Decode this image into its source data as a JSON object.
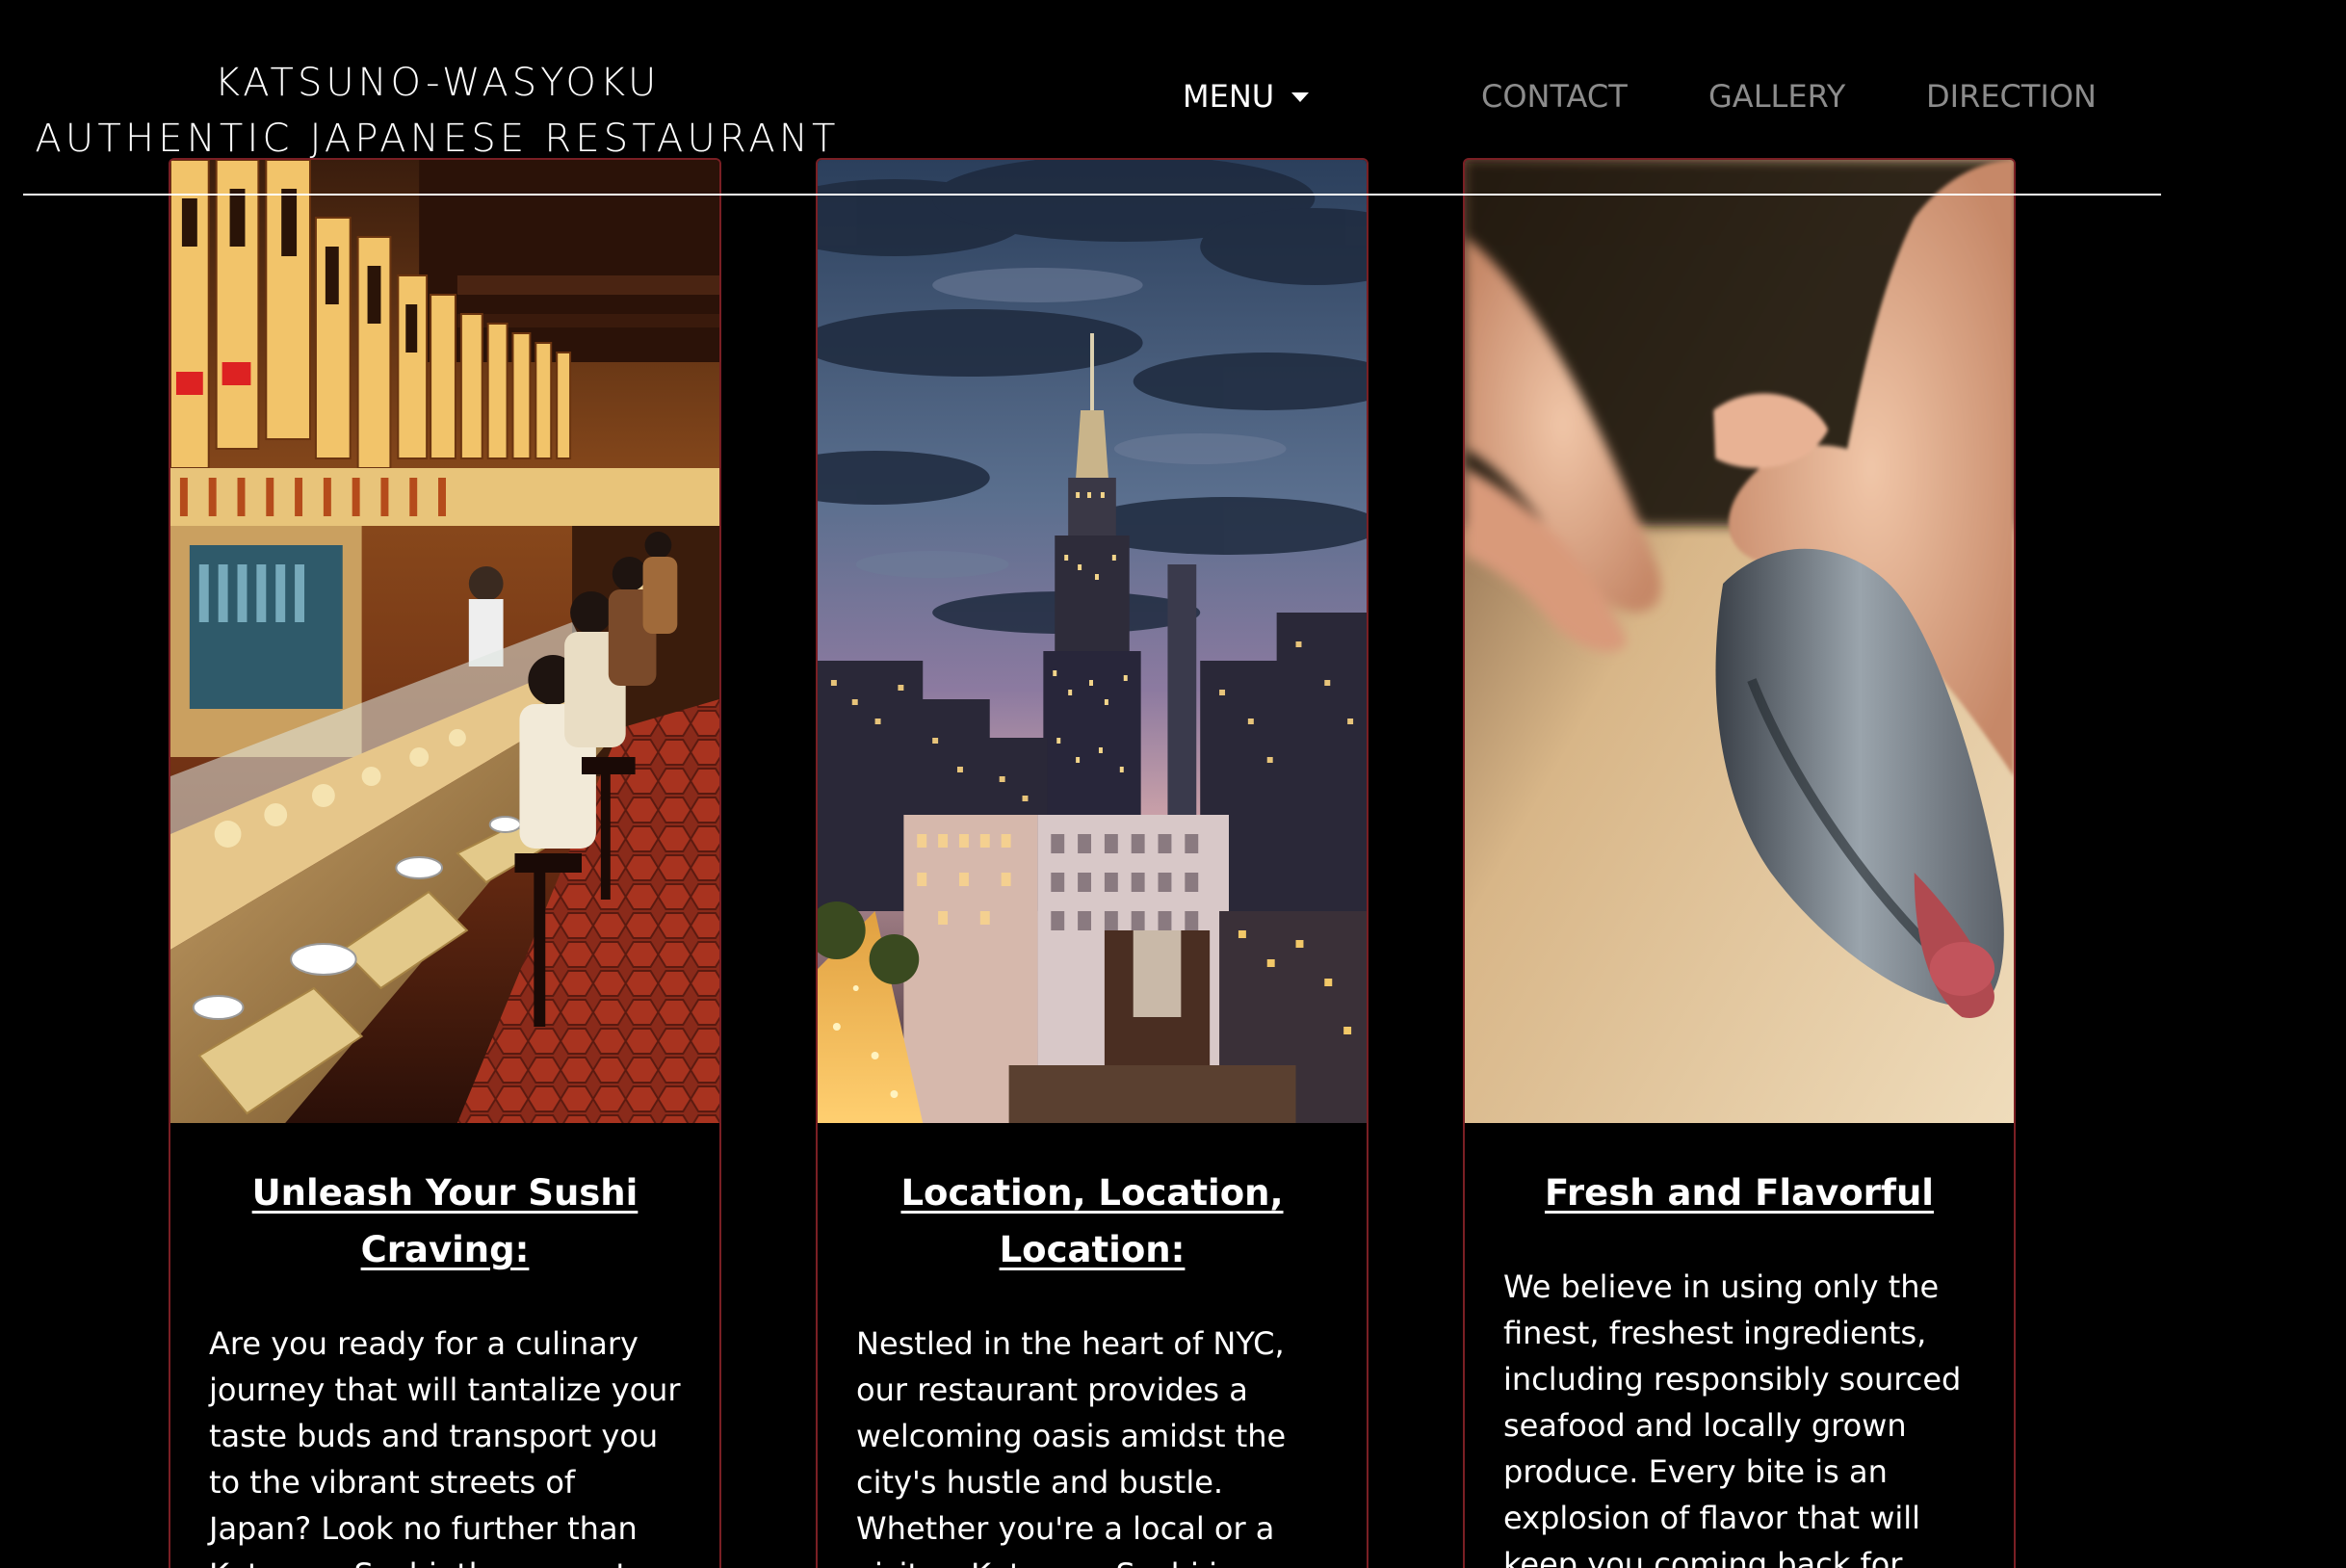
{
  "header": {
    "brand_line_1": "KATSUNO-WASYOKU",
    "brand_line_2": "AUTHENTIC JAPANESE RESTAURANT",
    "nav": {
      "menu": "MENU",
      "contact": "CONTACT",
      "gallery": "GALLERY",
      "direction": "DIRECTION"
    }
  },
  "cards": [
    {
      "image": "sushi-bar-interior-photo",
      "title": "Unleash Your Sushi Craving:",
      "text": "Are you ready for a culinary journey that will tantalize your taste buds and transport you to the vibrant streets of Japan? Look no further than Katsumo Sushi, the newest sensation in"
    },
    {
      "image": "nyc-empire-state-skyline-photo",
      "title": "Location, Location, Location:",
      "text": "Nestled in the heart of NYC, our restaurant provides a welcoming oasis amidst the city's hustle and bustle. Whether you're a local or a visitor, Katsumo Sushi is a convenient and memorable"
    },
    {
      "image": "chef-slicing-fish-photo",
      "title": "Fresh and Flavorful",
      "text": "We believe in using only the finest, freshest ingredients, including responsibly sourced seafood and locally grown produce. Every bite is an explosion of flavor that will keep you coming back for more."
    }
  ],
  "colors": {
    "background": "#000000",
    "card_border": "#7a1f24",
    "nav_inactive": "#8c8c8c",
    "text": "#ffffff"
  }
}
